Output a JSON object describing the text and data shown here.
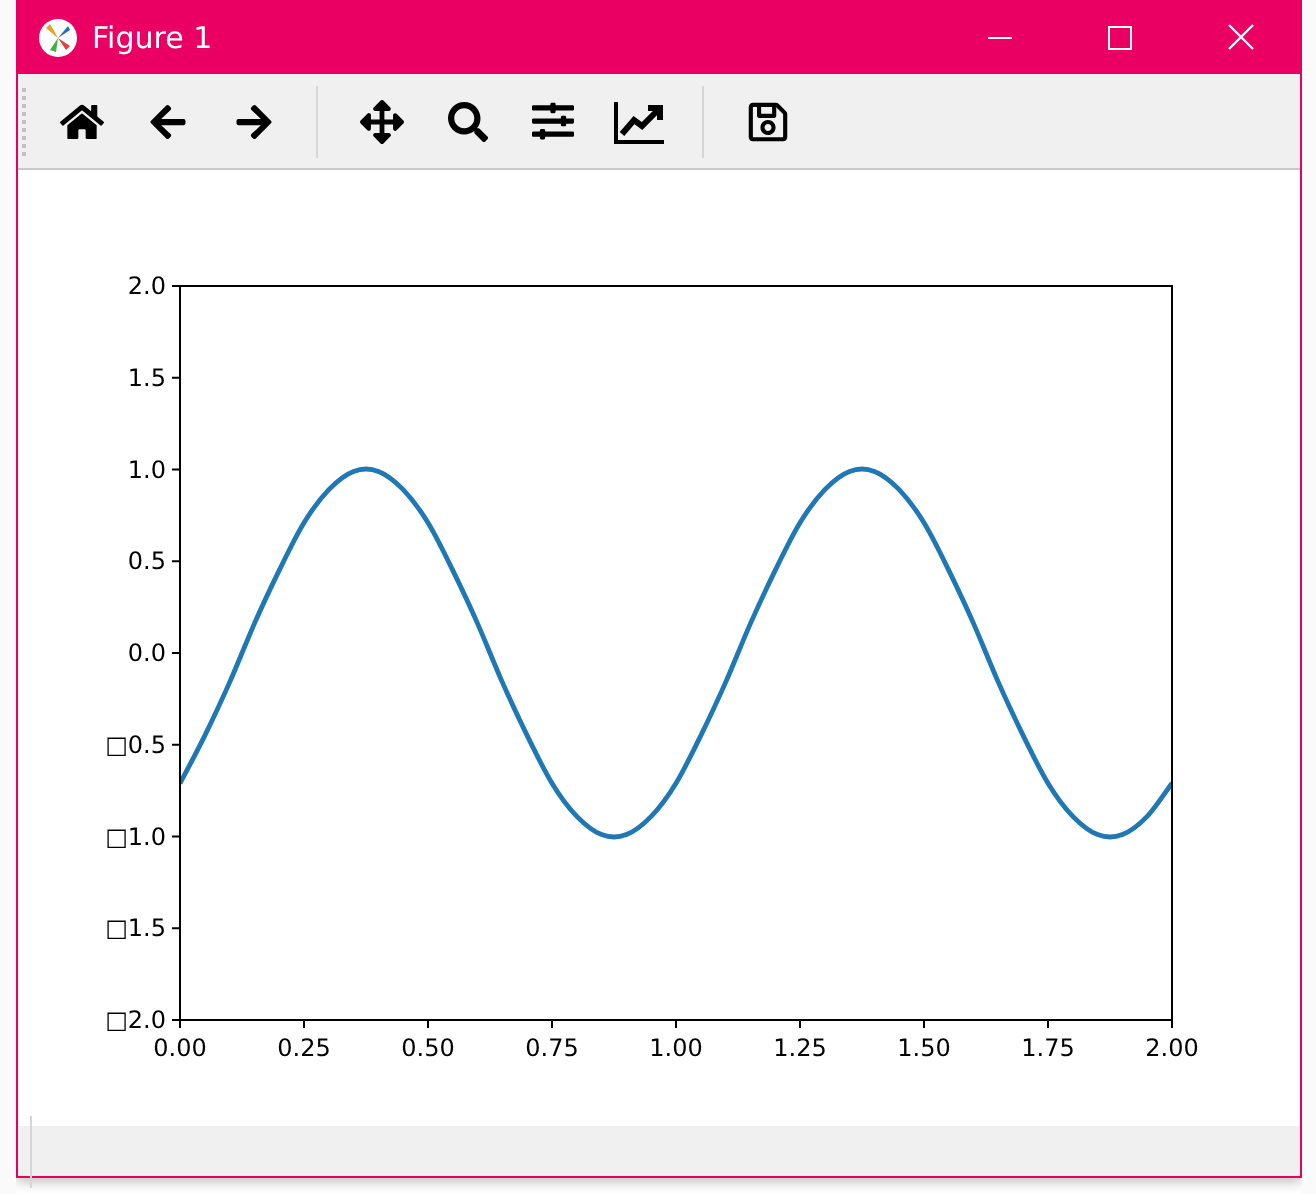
{
  "window": {
    "title": "Figure 1"
  },
  "toolbar": [
    {
      "kind": "home"
    },
    {
      "kind": "back"
    },
    {
      "kind": "forward"
    },
    {
      "kind": "separator"
    },
    {
      "kind": "pan"
    },
    {
      "kind": "zoom"
    },
    {
      "kind": "configure"
    },
    {
      "kind": "edit"
    },
    {
      "kind": "separator"
    },
    {
      "kind": "save"
    }
  ],
  "figure": {
    "chart_data": {
      "type": "line",
      "x": [
        0,
        0.05,
        0.1,
        0.15,
        0.2,
        0.25,
        0.3,
        0.35,
        0.4,
        0.45,
        0.5,
        0.55,
        0.6,
        0.65,
        0.7,
        0.75,
        0.8,
        0.85,
        0.9,
        0.95,
        1,
        1.05,
        1.1,
        1.15,
        1.2,
        1.25,
        1.3,
        1.35,
        1.4,
        1.45,
        1.5,
        1.55,
        1.6,
        1.65,
        1.7,
        1.75,
        1.8,
        1.85,
        1.9,
        1.95,
        2
      ],
      "series": [
        {
          "color": "#1f77b4",
          "values": [
            -0.71,
            -0.45,
            -0.16,
            0.16,
            0.45,
            0.71,
            0.89,
            0.99,
            0.99,
            0.89,
            0.71,
            0.45,
            0.16,
            -0.16,
            -0.45,
            -0.71,
            -0.89,
            -0.99,
            -0.99,
            -0.89,
            -0.71,
            -0.45,
            -0.16,
            0.16,
            0.45,
            0.71,
            0.89,
            0.99,
            0.99,
            0.89,
            0.71,
            0.45,
            0.16,
            -0.16,
            -0.45,
            -0.71,
            -0.89,
            -0.99,
            -0.99,
            -0.89,
            -0.71
          ]
        }
      ],
      "xlim": [
        0,
        2
      ],
      "ylim": [
        -2,
        2
      ],
      "xticks": [
        {
          "value": 0,
          "label": "0.00"
        },
        {
          "value": 0.25,
          "label": "0.25"
        },
        {
          "value": 0.5,
          "label": "0.50"
        },
        {
          "value": 0.75,
          "label": "0.75"
        },
        {
          "value": 1,
          "label": "1.00"
        },
        {
          "value": 1.25,
          "label": "1.25"
        },
        {
          "value": 1.5,
          "label": "1.50"
        },
        {
          "value": 1.75,
          "label": "1.75"
        },
        {
          "value": 2,
          "label": "2.00"
        }
      ],
      "yticks": [
        {
          "value": 2,
          "label": "2.0"
        },
        {
          "value": 1.5,
          "label": "1.5"
        },
        {
          "value": 1,
          "label": "1.0"
        },
        {
          "value": 0.5,
          "label": "0.5"
        },
        {
          "value": 0,
          "label": "0.0"
        },
        {
          "value": -0.5,
          "label": "□0.5"
        },
        {
          "value": -1,
          "label": "□1.0"
        },
        {
          "value": -1.5,
          "label": "□1.5"
        },
        {
          "value": -2,
          "label": "□2.0"
        }
      ]
    }
  }
}
